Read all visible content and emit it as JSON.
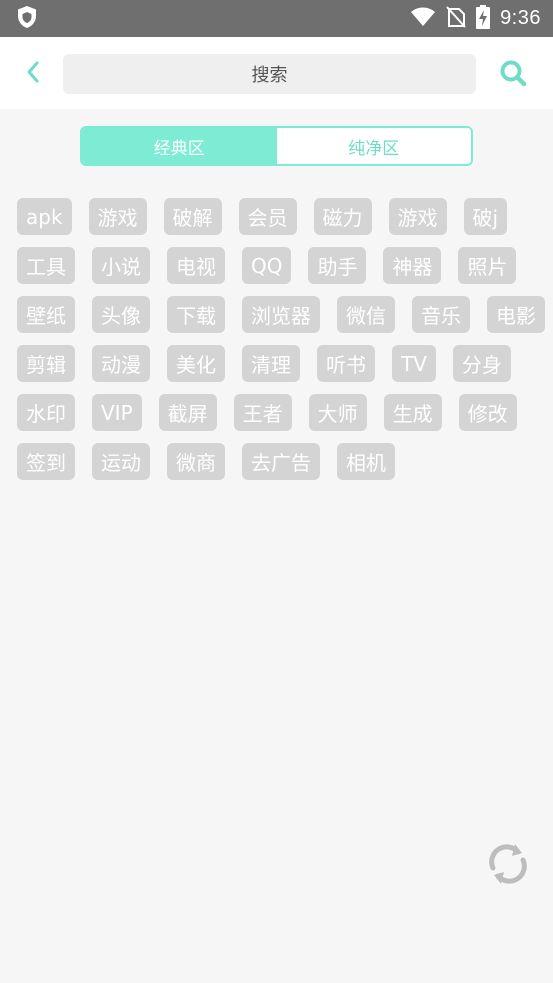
{
  "status_bar": {
    "time": "9:36"
  },
  "header": {
    "search_label": "搜索",
    "accent": "#6fdcc5"
  },
  "tabs": [
    {
      "label": "经典区",
      "active": true
    },
    {
      "label": "纯净区",
      "active": false
    }
  ],
  "tags": [
    "apk",
    "游戏",
    "破解",
    "会员",
    "磁力",
    "游戏",
    "破j",
    "工具",
    "小说",
    "电视",
    "QQ",
    "助手",
    "神器",
    "照片",
    "壁纸",
    "头像",
    "下载",
    "浏览器",
    "微信",
    "音乐",
    "电影",
    "剪辑",
    "动漫",
    "美化",
    "清理",
    "听书",
    "TV",
    "分身",
    "水印",
    "VIP",
    "截屏",
    "王者",
    "大师",
    "生成",
    "修改",
    "签到",
    "运动",
    "微商",
    "去广告",
    "相机"
  ],
  "colors": {
    "tag_bg": "#d4d4d4",
    "tab_active": "#7eebd4",
    "status_bar": "#6f6f6f"
  }
}
